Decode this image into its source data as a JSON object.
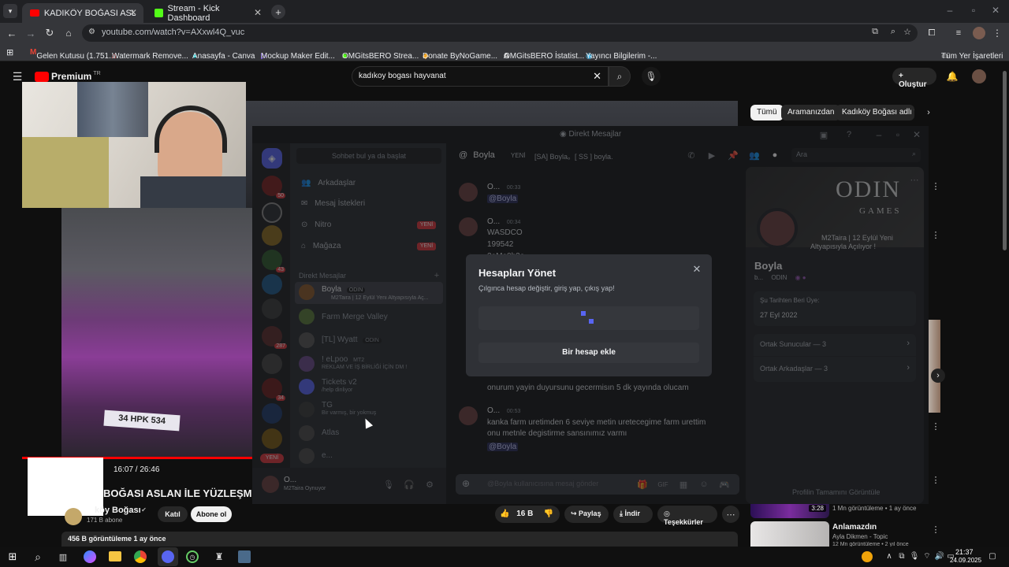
{
  "browser": {
    "tabs": [
      {
        "title": "KADIKÖY BOĞASI ASLAN İLE YÜZ",
        "active": true
      },
      {
        "title": "Stream - Kick Dashboard",
        "active": false
      }
    ],
    "url": "youtube.com/watch?v=AXxwl4Q_vuc",
    "bookmarks": [
      "Gelen Kutusu (1.751...",
      "Watermark Remove...",
      "Anasayfa - Canva",
      "Mockup Maker Edit...",
      "OMGitsBERO Strea...",
      "Donate ByNoGame...",
      "OMGitsBERO İstatist...",
      "Yayıncı Bilgilerim -..."
    ],
    "all_bookmarks": "Tüm Yer İşaretleri"
  },
  "youtube": {
    "logo": "Premium",
    "region": "TR",
    "search_value": "kadıkoy bogası hayvanat",
    "create_label": "Oluştur",
    "chips": [
      "Tümü",
      "Aramanızdan",
      "Kadıköy Boğası adlı yük"
    ],
    "video_time": "16:07 / 26:46",
    "video_title": "BOĞASI ASLAN İLE YÜZLEŞME",
    "channel_name": "köy Boğası",
    "subscribers": "171 B abone",
    "join_label": "Katıl",
    "subscribe_label": "Abone ol",
    "likes": "16 B",
    "share_label": "Paylaş",
    "download_label": "İndir",
    "thanks_label": "Teşekkürler",
    "views": "456 B görüntüleme  1 ay önce",
    "plate": "34 HPK 534",
    "rec_video1_meta": "1 Mn görüntüleme • 1 ay önce",
    "rec_video1_duration": "3:28",
    "rec_video2_title": "Anlamazdın",
    "rec_video2_artist": "Ayla Dikmen - Topic",
    "rec_video2_meta": "12 Mn görüntüleme • 2 yıl önce"
  },
  "discord": {
    "window_title": "Direkt Mesajlar",
    "search_placeholder": "Sohbet bul ya da başlat",
    "nav": [
      {
        "label": "Arkadaşlar",
        "badge": ""
      },
      {
        "label": "Mesaj İstekleri",
        "badge": ""
      },
      {
        "label": "Nitro",
        "badge": "YENİ"
      },
      {
        "label": "Mağaza",
        "badge": "YENİ"
      }
    ],
    "dm_header": "Direkt Mesajlar",
    "dms": [
      {
        "name": "Boyla",
        "tag": "ODIN",
        "sub": "M2Taira | 12 Eylül Yeni Altyapısıyla Aç..."
      },
      {
        "name": "Farm Merge Valley",
        "tag": "",
        "sub": ""
      },
      {
        "name": "[TL] Wyatt",
        "tag": "ODIN",
        "sub": ""
      },
      {
        "name": "! eLpoo",
        "tag": "MT2",
        "sub": "REKLAM VE İŞ BİRLİĞİ İÇİN DM !"
      },
      {
        "name": "Tickets v2",
        "tag": "",
        "sub": "/help dinliyor"
      },
      {
        "name": "TG",
        "tag": "",
        "sub": "Bir varmış, bir yokmuş"
      },
      {
        "name": "Atlas",
        "tag": "",
        "sub": ""
      },
      {
        "name": "e...",
        "tag": "",
        "sub": ""
      }
    ],
    "server_badges": [
      "50",
      "43",
      "287",
      "34",
      "YENİ"
    ],
    "user_name": "O...",
    "user_status": "M2Taira Oynuyor",
    "chat_user": "Boyla",
    "chat_new": "YENİ",
    "chat_topic": "[SA] Boyla。[ SS ] boyla.",
    "chat_search": "Ara",
    "messages": [
      {
        "author": "O...",
        "time": "00:33",
        "lines": [
          "@Boyla"
        ]
      },
      {
        "author": "O...",
        "time": "00:34",
        "lines": [
          "WASDCO",
          "199542",
          "2aMe0b3a"
        ]
      },
      {
        "author": "",
        "time": "",
        "lines": [
          "onurum yayin duyursunu gecermisın 5 dk yayında olucam"
        ]
      },
      {
        "author": "O...",
        "time": "00:53",
        "lines": [
          "kanka farm uretimden 6 seviye metin uretecegime farm urettim",
          "onu metnle degistirme sansınımız varmı",
          "@Boyla"
        ]
      }
    ],
    "composer_placeholder": "@Boyla kullanıcısına mesaj gönder",
    "profile": {
      "name": "Boyla",
      "tag": "ODIN",
      "banner_line1": "M2Taira | 12 Eylül Yeni",
      "banner_line2": "Altyapısıyla Açılıyor !",
      "brand": "ODIN",
      "brand_sub": "GAMES",
      "member_since_label": "Şu Tarihten Beri Üye:",
      "member_since": "27 Eyl 2022",
      "mutual_servers": "Ortak Sunucular — 3",
      "mutual_friends": "Ortak Arkadaşlar — 3",
      "full_profile": "Profilin Tamamını Görüntüle"
    },
    "modal": {
      "title": "Hesapları Yönet",
      "subtitle": "Çılgınca hesap değiştir, giriş yap, çıkış yap!",
      "add_account": "Bir hesap ekle"
    }
  },
  "taskbar": {
    "time": "21:37",
    "date": "24.09.2025"
  },
  "colors": {
    "yt_red": "#ff0000",
    "discord_bg": "#151618",
    "discord_blurple": "#5865f2",
    "yeni_red": "#da373c"
  }
}
